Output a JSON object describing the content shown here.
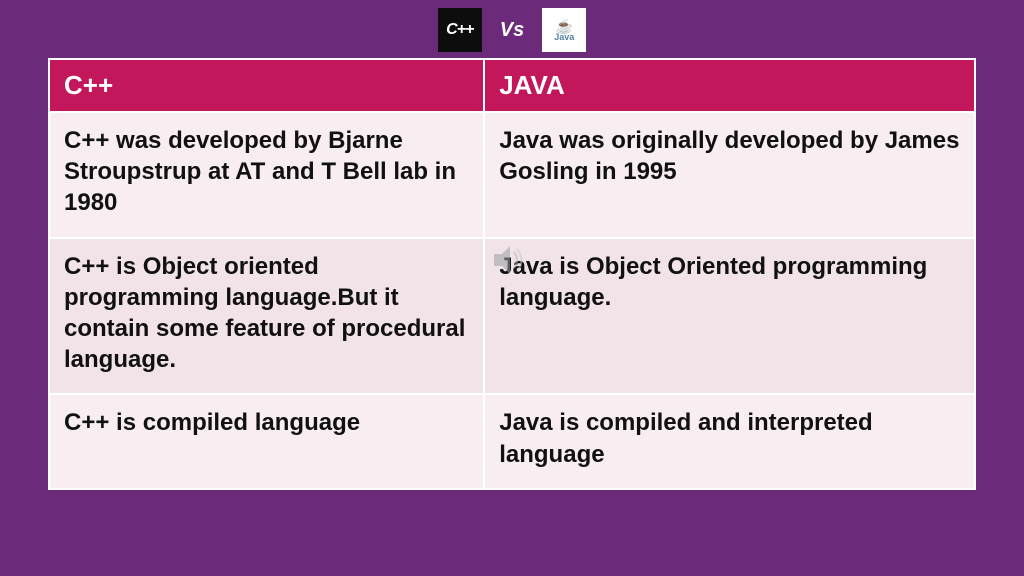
{
  "header": {
    "cpp_logo_text": "C++",
    "vs_text": "Vs",
    "java_logo_cup": "☕",
    "java_logo_text": "Java"
  },
  "table": {
    "headers": {
      "left": "C++",
      "right": "JAVA"
    },
    "rows": [
      {
        "left": "C++ was developed by Bjarne Stroupstrup at AT and T Bell lab in 1980",
        "right": "Java was originally developed by James Gosling in 1995"
      },
      {
        "left": "C++ is Object oriented programming language.But it contain some feature of procedural language.",
        "right": "Java is Object Oriented programming language."
      },
      {
        "left": "C++ is compiled language",
        "right": "Java is compiled and interpreted language"
      }
    ]
  }
}
